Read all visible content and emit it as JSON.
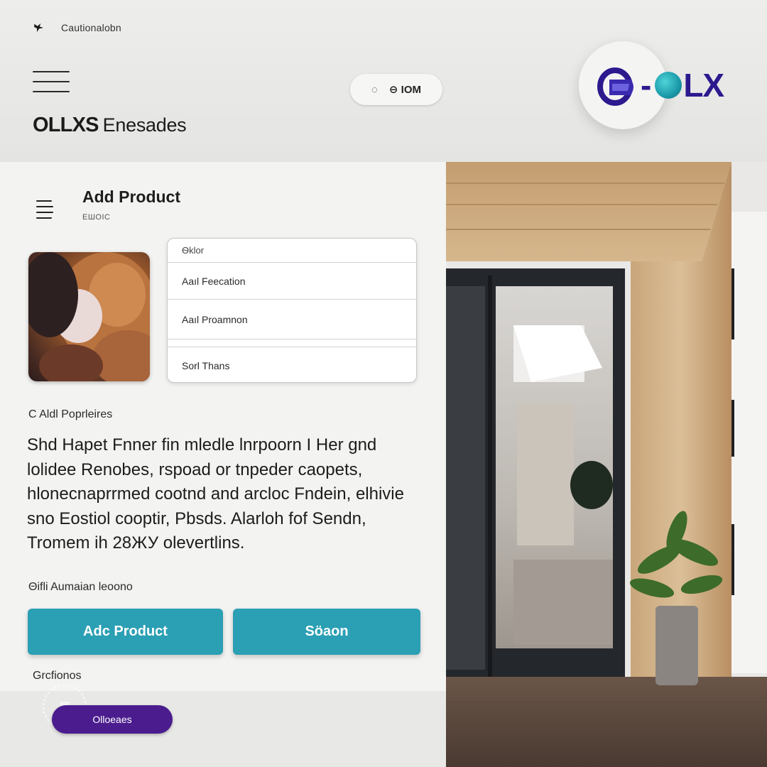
{
  "header": {
    "top_text": "Cautionalobn",
    "brand_bold": "OLLXS",
    "brand_rest": "Enesades",
    "pill_icon_text": "◌",
    "pill_text": "⊖ IOM",
    "logo_text_a": "-",
    "logo_text_b": "LX"
  },
  "card": {
    "title": "Add Product",
    "subtitle": "ЕШОІС",
    "options": [
      "Ѳklor",
      "Aaıl Feecation",
      "Aaıl Proamnon",
      "Sorl Thans"
    ],
    "section_label": "C Aldl Poprleires",
    "description": "Shd Hapet Fnner fin mledle lnrpoorn I Her gnd lolidee Renobes, rspoad or tnpeder caopets, hlonecnaprrmed cootnd and arcloc Fndein, elhivie sno Eostiol cooptir, Pbsds. Alarloh fof Sendn, Tromem ih 28ЖУ olevertlins.",
    "meta_label": "Θifli Aumaian leoono",
    "buttons": {
      "add": "Adc Product",
      "search": "Söaon"
    },
    "footer_label": "Grcfionos",
    "badge": "Olloeaes"
  },
  "colors": {
    "accent": "#2b9fb4",
    "brand_purple": "#2c1a8e",
    "badge_purple": "#4b1c8e",
    "teal_dot": "#1a9aa9"
  },
  "icons": {
    "top": "bird-icon",
    "menu": "hamburger-icon",
    "card_menu": "list-icon",
    "logo": "olx-logo-mark"
  }
}
